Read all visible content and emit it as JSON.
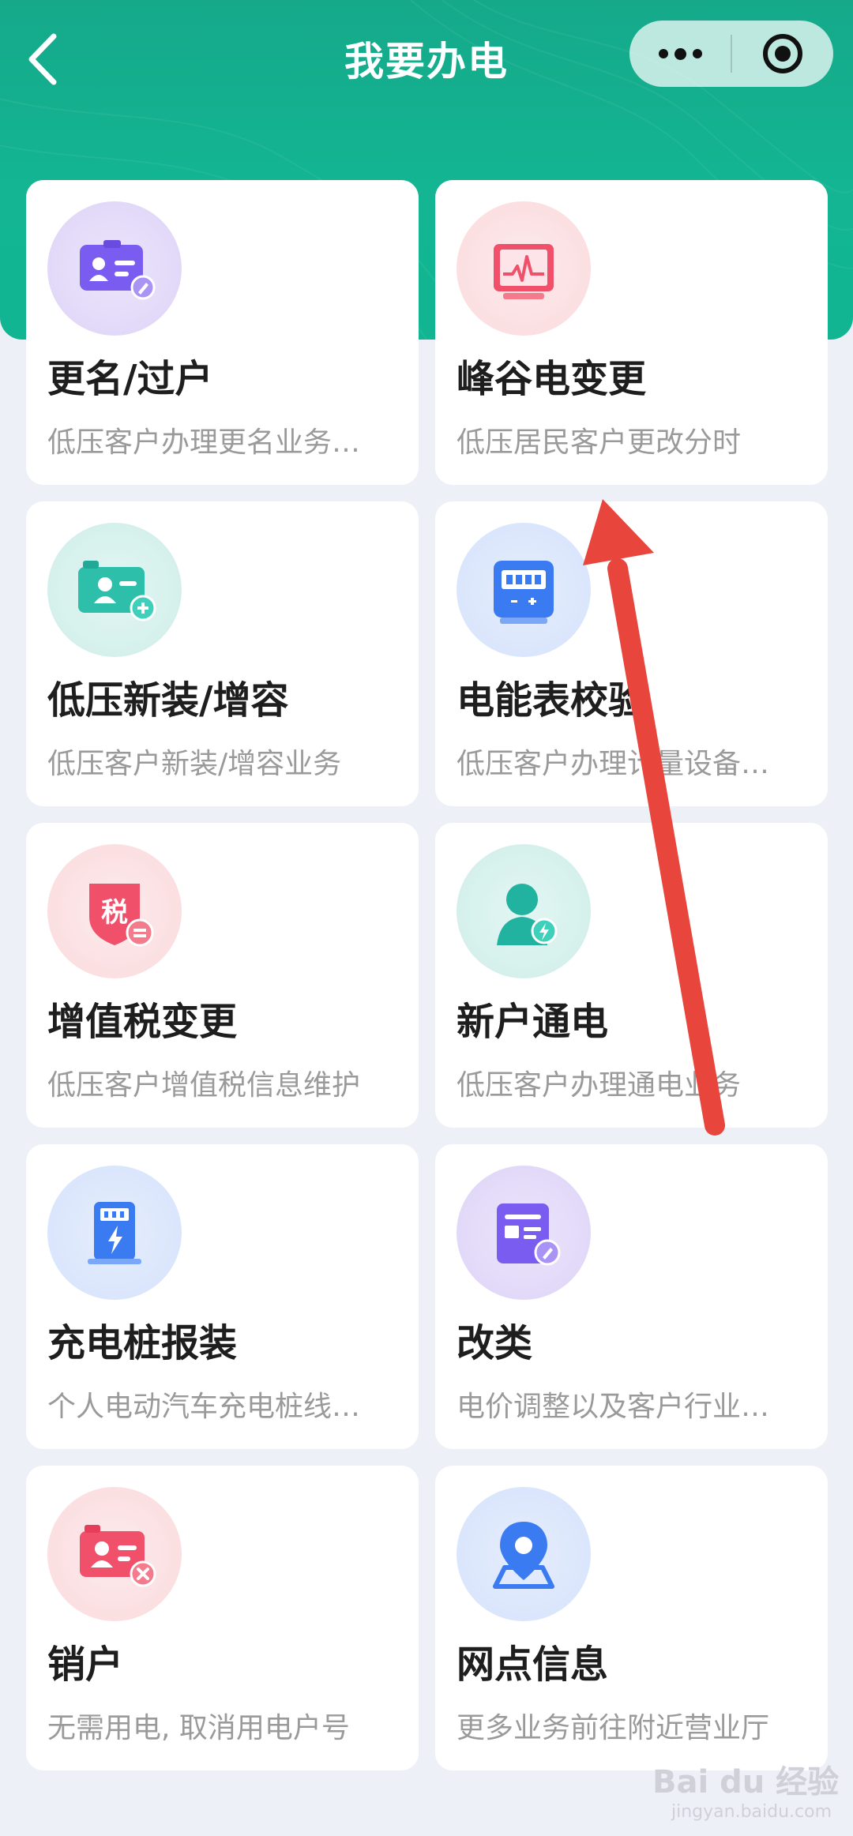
{
  "header": {
    "title": "我要办电",
    "colors": {
      "accent": "#13b592",
      "header_top": "#15a98a"
    }
  },
  "capsule": {
    "more_icon": "more-dots-icon",
    "close_icon": "target-circle-icon"
  },
  "services": [
    {
      "name": "更名/过户",
      "desc": "低压客户办理更名业务…",
      "icon": "id-card-edit-icon",
      "tone": "purple"
    },
    {
      "name": "峰谷电变更",
      "desc": "低压居民客户更改分时",
      "icon": "monitor-pulse-icon",
      "tone": "pink"
    },
    {
      "name": "低压新装/增容",
      "desc": "低压客户新装/增容业务",
      "icon": "id-card-add-icon",
      "tone": "teal"
    },
    {
      "name": "电能表校验",
      "desc": "低压客户办理计量设备…",
      "icon": "electric-meter-icon",
      "tone": "blue"
    },
    {
      "name": "增值税变更",
      "desc": "低压客户增值税信息维护",
      "icon": "tax-shield-icon",
      "tone": "pink"
    },
    {
      "name": "新户通电",
      "desc": "低压客户办理通电业务",
      "icon": "user-bolt-icon",
      "tone": "teal"
    },
    {
      "name": "充电桩报装",
      "desc": "个人电动汽车充电桩线…",
      "icon": "charging-pile-icon",
      "tone": "blue"
    },
    {
      "name": "改类",
      "desc": "电价调整以及客户行业…",
      "icon": "document-edit-icon",
      "tone": "purple"
    },
    {
      "name": "销户",
      "desc": "无需用电, 取消用电户号",
      "icon": "id-card-remove-icon",
      "tone": "pink"
    },
    {
      "name": "网点信息",
      "desc": "更多业务前往附近营业厅",
      "icon": "map-pin-icon",
      "tone": "blue"
    }
  ],
  "watermark": {
    "text": "Bai du 经验",
    "sub": "jingyan.baidu.com"
  }
}
